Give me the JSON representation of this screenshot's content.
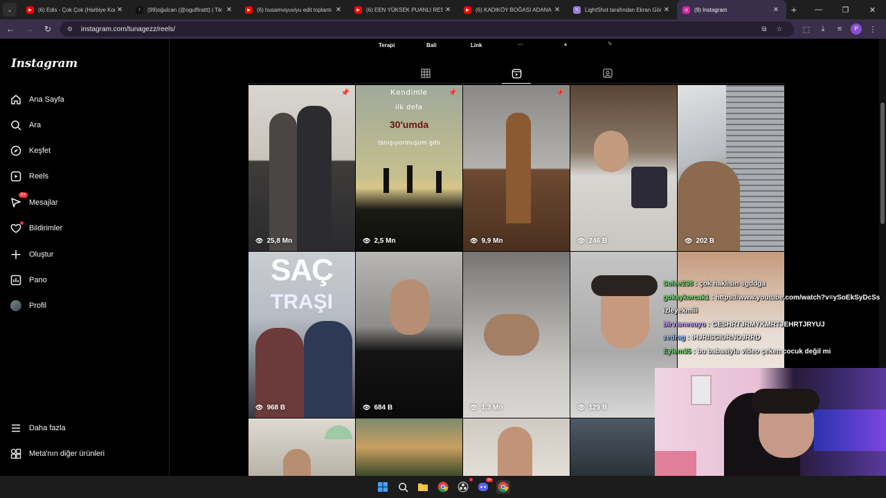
{
  "browser": {
    "tabs": [
      {
        "label": "(6) Edis - Çok Çok (Harbiye Kon",
        "favicon": "youtube-icon",
        "color": "#ff0000",
        "active": false
      },
      {
        "label": "(99)oğulcan (@ogulfirattt) | Tik",
        "favicon": "tiktok-icon",
        "color": "#111111",
        "active": false
      },
      {
        "label": "(6) husamviyuviyu edit toplantı",
        "favicon": "youtube-icon",
        "color": "#ff0000",
        "active": false
      },
      {
        "label": "(6) EEN YÜKSEK PUANLI RESTO",
        "favicon": "youtube-icon",
        "color": "#ff0000",
        "active": false
      },
      {
        "label": "(6) KADIKÖY BOĞASI ADANA Y",
        "favicon": "youtube-icon",
        "color": "#ff0000",
        "active": false
      },
      {
        "label": "LightShot tarafından Ekran Gör",
        "favicon": "feather-icon",
        "color": "#9b7bd6",
        "active": false
      },
      {
        "label": "(9) Instagram",
        "favicon": "instagram-icon",
        "color": "#d6249f",
        "active": true
      }
    ],
    "url": "instagram.com/tunagezz/reels/",
    "profile_initial": "P"
  },
  "highlights": {
    "labels": [
      "Terapi",
      "Bali",
      "Link"
    ]
  },
  "sidebar": {
    "logo": "Instagram",
    "items": [
      {
        "label": "Ana Sayfa",
        "icon": "home-icon"
      },
      {
        "label": "Ara",
        "icon": "search-icon"
      },
      {
        "label": "Keşfet",
        "icon": "compass-icon"
      },
      {
        "label": "Reels",
        "icon": "reels-icon"
      },
      {
        "label": "Mesajlar",
        "icon": "messenger-icon",
        "badge": "9+"
      },
      {
        "label": "Bildirimler",
        "icon": "heart-icon"
      },
      {
        "label": "Oluştur",
        "icon": "plus-icon"
      },
      {
        "label": "Pano",
        "icon": "dashboard-icon"
      },
      {
        "label": "Profil",
        "icon": "avatar"
      }
    ],
    "more": "Daha fazla",
    "meta": "Meta'nın diğer ürünleri"
  },
  "reels": [
    {
      "views": "25,8 Mn",
      "pinned": true
    },
    {
      "views": "2,5 Mn",
      "pinned": true,
      "overlay": [
        "Kendimle",
        "ilk defa",
        "30'umda",
        "tanışıyormuşum gibi"
      ]
    },
    {
      "views": "9,9 Mn",
      "pinned": true
    },
    {
      "views": "246 B",
      "pinned": false
    },
    {
      "views": "202 B",
      "pinned": false
    },
    {
      "views": "968 B",
      "pinned": false,
      "overlay": [
        "SAÇ",
        "TRAŞI"
      ]
    },
    {
      "views": "684 B",
      "pinned": false
    },
    {
      "views": "1,3 Mn",
      "pinned": false
    },
    {
      "views": "129 B",
      "pinned": false
    }
  ],
  "chat": [
    {
      "user": "Sulee238",
      "msg": "çok haklısın sgddga",
      "color": "#7fe07f"
    },
    {
      "user": "gokaykorcak1",
      "msg": "https://www.youtube.com/watch?v=ySoEkSyDcSs",
      "color": "#7fe07f"
    },
    {
      "user": "",
      "msg": "izleyekmiii",
      "color": "#ffffff"
    },
    {
      "user": "birvisnesuyu",
      "msg": "GESHRTJRMYKMRTJEHRTJRYUJ",
      "color": "#c8a6ff"
    },
    {
      "user": "zedrag",
      "msg": "IHJRISGIURNOJRRD",
      "color": "#9ec7ff"
    },
    {
      "user": "Eylem35",
      "msg": "bu babasiyla video çeken cocuk değil mi",
      "color": "#7fe07f"
    }
  ],
  "taskbar": {
    "discord_badge": "9+"
  }
}
